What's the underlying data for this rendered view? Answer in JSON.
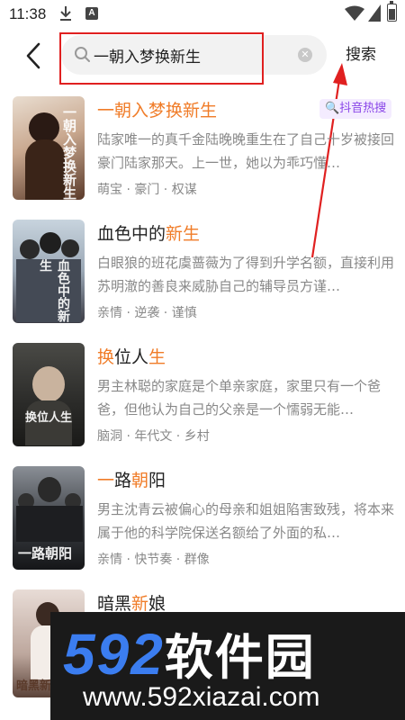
{
  "status_bar": {
    "time": "11:38",
    "app_glyph": "A"
  },
  "header": {
    "search_value": "一朝入梦换新生",
    "search_button": "搜索"
  },
  "results": [
    {
      "title_plain": "",
      "title_highlight": "一朝入梦换新生",
      "title_tail": "",
      "badge": "抖音热搜",
      "desc": "陆家唯一的真千金陆晚晚重生在了自己十岁被接回豪门陆家那天。上一世，她以为乖巧懂…",
      "tags": "萌宝 · 豪门 · 权谋",
      "cover_text": "一朝入梦换新生"
    },
    {
      "title_plain": "血色中的",
      "title_highlight": "新生",
      "title_tail": "",
      "badge": "",
      "desc": "白眼狼的班花虞蔷薇为了得到升学名额，直接利用苏明澈的善良来威胁自己的辅导员方谨…",
      "tags": "亲情 · 逆袭 · 谨慎",
      "cover_text": "血色中的新生"
    },
    {
      "title_plain": "",
      "title_highlight": "换",
      "title_tail": "位人",
      "title_highlight2": "生",
      "badge": "",
      "desc": "男主林聪的家庭是个单亲家庭，家里只有一个爸爸，但他认为自己的父亲是一个懦弱无能…",
      "tags": "脑洞 · 年代文 · 乡村",
      "cover_text": "换位人生"
    },
    {
      "title_plain": "",
      "title_highlight": "一",
      "title_tail": "路",
      "title_highlight2": "朝",
      "title_tail2": "阳",
      "badge": "",
      "desc": "男主沈青云被偏心的母亲和姐姐陷害致残，将本来属于他的科学院保送名额给了外面的私…",
      "tags": "亲情 · 快节奏 · 群像",
      "cover_text": "一路朝阳"
    },
    {
      "title_plain": "暗黑",
      "title_highlight": "新",
      "title_tail": "娘",
      "badge": "",
      "desc": "",
      "tags": "",
      "cover_text": "暗黑新娘"
    }
  ],
  "watermark": {
    "logo_num": "592",
    "logo_cn": "软件园",
    "url": "www.592xiazai.com"
  },
  "colors": {
    "highlight": "#f07c28",
    "annotation": "#e02020",
    "badge": "#8a46e8"
  },
  "icons": [
    "download-icon",
    "app-a-icon",
    "wifi-icon",
    "signal-icon",
    "battery-icon",
    "back-arrow-icon",
    "search-icon",
    "clear-icon"
  ]
}
